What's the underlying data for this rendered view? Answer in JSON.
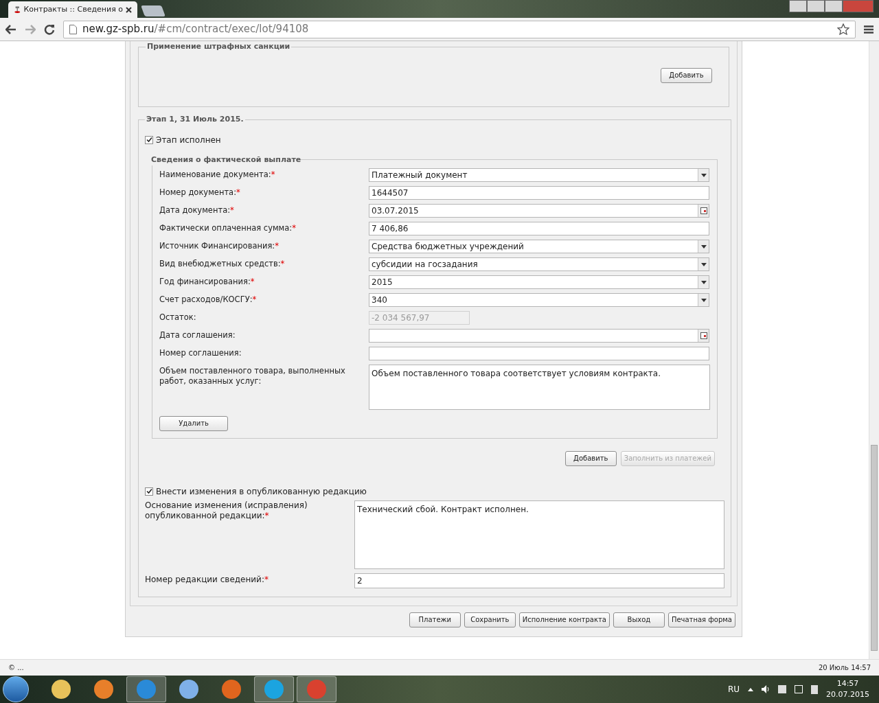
{
  "browser": {
    "tab_title": "Контракты :: Сведения о",
    "url_host": "new.gz-spb.ru",
    "url_path": "/#cm/contract/exec/lot/94108"
  },
  "penalties": {
    "legend": "Применение штрафных санкции",
    "add_button": "Добавить"
  },
  "stage": {
    "legend": "Этап 1, 31 Июль 2015.",
    "done": {
      "label": "Этап исполнен",
      "checked": true
    },
    "payment": {
      "legend": "Сведения о фактической выплате",
      "fields": [
        {
          "kind": "select",
          "label": "Наименование документа:",
          "required_mark": "*",
          "value": "Платежный документ"
        },
        {
          "kind": "text",
          "label": "Номер документа:",
          "required_mark": "*",
          "value": "1644507"
        },
        {
          "kind": "date",
          "label": "Дата документа:",
          "required_mark": "*",
          "value": "03.07.2015"
        },
        {
          "kind": "text",
          "label": "Фактически оплаченная сумма:",
          "required_mark": "*",
          "value": "7 406,86"
        },
        {
          "kind": "select",
          "label": "Источник Финансирования:",
          "required_mark": "*",
          "value": "Средства бюджетных учреждений"
        },
        {
          "kind": "select",
          "label": "Вид внебюджетных средств:",
          "required_mark": "*",
          "value": "субсидии на госзадания"
        },
        {
          "kind": "select",
          "label": "Год финансирования:",
          "required_mark": "*",
          "value": "2015"
        },
        {
          "kind": "select",
          "label": "Счет расходов/КОСГУ:",
          "required_mark": "*",
          "value": "340"
        },
        {
          "kind": "text",
          "label": "Остаток:",
          "disabled": true,
          "value": "-2 034 567,97"
        },
        {
          "kind": "date",
          "label": "Дата соглашения:"
        },
        {
          "kind": "text",
          "label": "Номер соглашения:"
        },
        {
          "kind": "textarea",
          "label": "Объем поставленного товара, выполненных работ, оказанных услуг:",
          "value": "Объем поставленного товара соответствует условиям контракта."
        }
      ],
      "delete_button": "Удалить"
    },
    "add_button": "Добавить",
    "fill_button": {
      "label": "Заполнить из платежей",
      "disabled": true
    },
    "edit": {
      "label": "Внести изменения в опубликованную редакцию",
      "checked": true
    },
    "reason": {
      "label": "Основание изменения (исправления) опубликованной редакции:",
      "required_mark": "*",
      "value": "Технический сбой. Контракт исполнен."
    },
    "revision": {
      "label": "Номер редакции сведений:",
      "required_mark": "*",
      "value": "2"
    }
  },
  "footer_buttons": [
    "Платежи",
    "Сохранить",
    "Исполнение контракта",
    "Выход",
    "Печатная форма"
  ],
  "status_bar": {
    "left": "© ...",
    "right": "20 Июль 14:57"
  },
  "taskbar": {
    "buttons": [
      {
        "active": false
      },
      {
        "active": false
      },
      {
        "active": true
      },
      {
        "active": false
      },
      {
        "active": false
      },
      {
        "active": true
      },
      {
        "active": true
      }
    ],
    "lang": "RU",
    "time": "14:57",
    "date": "20.07.2015"
  }
}
